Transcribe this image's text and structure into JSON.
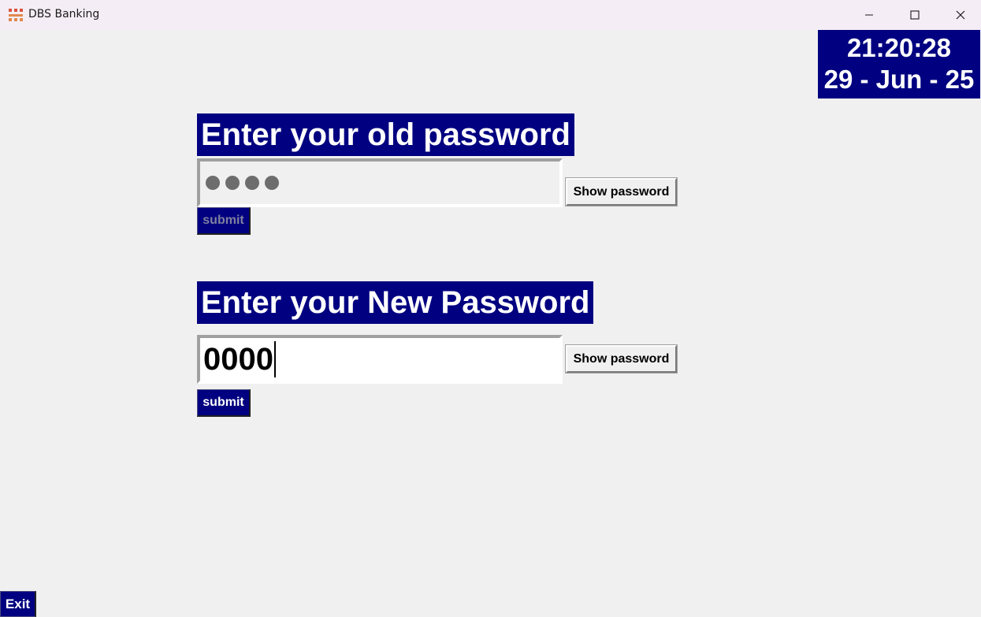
{
  "window": {
    "title": "DBS Banking",
    "app_icon": "dbs-logo-icon",
    "controls": [
      "minimize-icon",
      "maximize-icon",
      "close-icon"
    ]
  },
  "clock": {
    "time": "21:20:28",
    "date": "29 - Jun - 25"
  },
  "old_password": {
    "heading": "Enter your old password",
    "masked_count": 4,
    "show_label": "Show password",
    "submit_label": "submit",
    "submit_enabled": false
  },
  "new_password": {
    "heading": "Enter your New Password",
    "value": "0000",
    "show_label": "Show password",
    "submit_label": "submit",
    "submit_enabled": true
  },
  "exit_label": "Exit",
  "colors": {
    "accent": "#000080",
    "background": "#f0f0f0",
    "titlebar": "#f5edf5",
    "text_light": "#ffffff",
    "disabled_text": "#8080a0"
  }
}
